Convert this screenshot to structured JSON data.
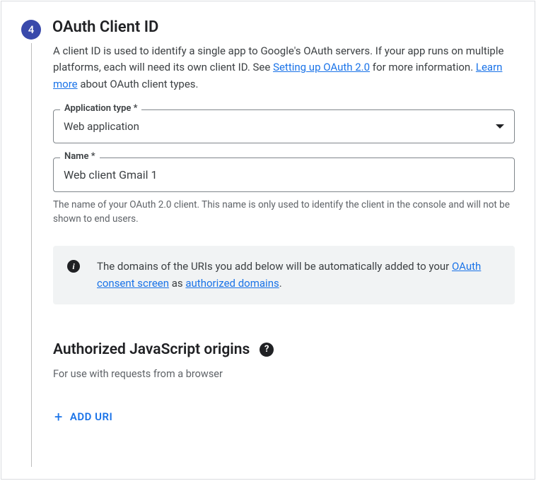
{
  "step": {
    "number": "4",
    "title": "OAuth Client ID"
  },
  "description": {
    "text1": "A client ID is used to identify a single app to Google's OAuth servers. If your app runs on multiple platforms, each will need its own client ID. See ",
    "link1": "Setting up OAuth 2.0",
    "text2": " for more information. ",
    "link2": "Learn more",
    "text3": " about OAuth client types."
  },
  "app_type": {
    "label": "Application type *",
    "value": "Web application"
  },
  "name_field": {
    "label": "Name *",
    "value": "Web client Gmail 1",
    "helper": "The name of your OAuth 2.0 client. This name is only used to identify the client in the console and will not be shown to end users."
  },
  "info_box": {
    "text1": "The domains of the URIs you add below will be automatically added to your ",
    "link1": "OAuth consent screen",
    "text2": " as ",
    "link2": "authorized domains",
    "text3": "."
  },
  "origins_section": {
    "title": "Authorized JavaScript origins",
    "description": "For use with requests from a browser",
    "add_button": "ADD URI"
  }
}
